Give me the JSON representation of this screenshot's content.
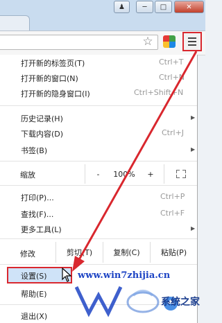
{
  "window": {
    "controls": [
      "user-icon",
      "minimize-icon",
      "maximize-icon",
      "close-icon"
    ]
  },
  "toolbar": {
    "icons": [
      "star-icon",
      "extension-icon",
      "menu-icon"
    ]
  },
  "menu": {
    "group1": [
      {
        "label": "打开新的标签页(T)",
        "shortcut": "Ctrl+T"
      },
      {
        "label": "打开新的窗口(N)",
        "shortcut": "Ctrl+N"
      },
      {
        "label": "打开新的隐身窗口(I)",
        "shortcut": "Ctrl+Shift+N"
      }
    ],
    "group2": [
      {
        "label": "历史记录(H)",
        "submenu": true
      },
      {
        "label": "下载内容(D)",
        "shortcut": "Ctrl+J"
      },
      {
        "label": "书签(B)",
        "submenu": true
      }
    ],
    "zoom": {
      "label": "缩放",
      "minus": "-",
      "value": "100%",
      "plus": "+"
    },
    "group3": [
      {
        "label": "打印(P)...",
        "shortcut": "Ctrl+P"
      },
      {
        "label": "查找(F)...",
        "shortcut": "Ctrl+F"
      },
      {
        "label": "更多工具(L)",
        "submenu": true
      }
    ],
    "edit": {
      "label": "修改",
      "cut": "剪切(T)",
      "copy": "复制(C)",
      "paste": "粘贴(P)"
    },
    "group4": [
      {
        "label": "设置(S)"
      },
      {
        "label": "帮助(E)",
        "submenu": true
      }
    ],
    "exit": {
      "label": "退出(X)"
    }
  },
  "watermark": {
    "url": "www.win7zhijia.cn",
    "brand": "系统之家"
  },
  "colors": {
    "highlight_border": "#d9272e",
    "annotation_arrow": "#d9272e",
    "watermark_blue": "#1d44c4"
  }
}
